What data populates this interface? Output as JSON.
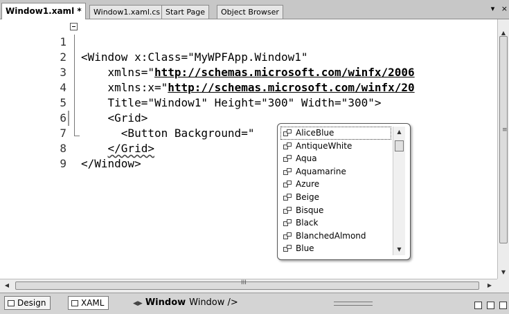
{
  "tabs": [
    {
      "label": "Window1.xaml *",
      "active": true
    },
    {
      "label": "Window1.xaml.cs",
      "active": false
    },
    {
      "label": "Start Page",
      "active": false
    },
    {
      "label": "Object Browser",
      "active": false
    }
  ],
  "tab_controls": {
    "dropdown": "▾",
    "close": "×"
  },
  "editor": {
    "lines": [
      {
        "num": "1",
        "text": "<Window x:Class=\"MyWPFApp.Window1\""
      },
      {
        "num": "2",
        "pre": "    xmlns=\"",
        "url": "http://schemas.microsoft.com/winfx/2006"
      },
      {
        "num": "3",
        "pre": "    xmlns:x=\"",
        "url": "http://schemas.microsoft.com/winfx/20"
      },
      {
        "num": "4",
        "text": "    Title=\"Window1\" Height=\"300\" Width=\"300\">"
      },
      {
        "num": "5",
        "text": "    <Grid>"
      },
      {
        "num": "6",
        "text": "      <Button Background=\""
      },
      {
        "num": "7",
        "pre": "    ",
        "squiggle": "</Grid>"
      },
      {
        "num": "8",
        "text": "</Window>"
      },
      {
        "num": "9",
        "text": ""
      }
    ]
  },
  "intellisense": {
    "items": [
      "AliceBlue",
      "AntiqueWhite",
      "Aqua",
      "Aquamarine",
      "Azure",
      "Beige",
      "Bisque",
      "Black",
      "BlanchedAlmond",
      "Blue"
    ],
    "selected_index": 0
  },
  "scrollbars": {
    "grip": "≡",
    "hgrip": "III"
  },
  "bottombar": {
    "design_label": "Design",
    "xaml_label": "XAML",
    "crumb_nav": "◀▶",
    "crumb_bold": "Window",
    "crumb_text": "Window />"
  },
  "colors": {
    "accent": "#000000",
    "tabstrip": "#c7c7c7"
  }
}
